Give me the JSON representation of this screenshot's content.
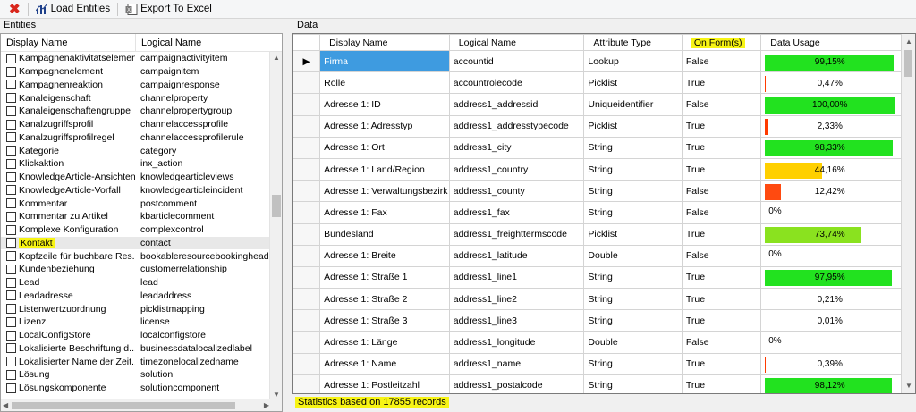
{
  "toolbar": {
    "load_label": "Load Entities",
    "export_label": "Export To Excel"
  },
  "entities_title": "Entities",
  "data_title": "Data",
  "left_columns": [
    "Display Name",
    "Logical Name"
  ],
  "entities": [
    {
      "display": "Kampagnenaktivitätselement",
      "logical": "campaignactivityitem"
    },
    {
      "display": "Kampagnenelement",
      "logical": "campaignitem"
    },
    {
      "display": "Kampagnenreaktion",
      "logical": "campaignresponse"
    },
    {
      "display": "Kanaleigenschaft",
      "logical": "channelproperty"
    },
    {
      "display": "Kanaleigenschaftengruppe",
      "logical": "channelpropertygroup"
    },
    {
      "display": "Kanalzugriffsprofil",
      "logical": "channelaccessprofile"
    },
    {
      "display": "Kanalzugriffsprofilregel",
      "logical": "channelaccessprofilerule"
    },
    {
      "display": "Kategorie",
      "logical": "category"
    },
    {
      "display": "Klickaktion",
      "logical": "inx_action"
    },
    {
      "display": "KnowledgeArticle-Ansichten",
      "logical": "knowledgearticleviews"
    },
    {
      "display": "KnowledgeArticle-Vorfall",
      "logical": "knowledgearticleincident"
    },
    {
      "display": "Kommentar",
      "logical": "postcomment"
    },
    {
      "display": "Kommentar zu Artikel",
      "logical": "kbarticlecomment"
    },
    {
      "display": "Komplexe Konfiguration",
      "logical": "complexcontrol"
    },
    {
      "display": "Kontakt",
      "logical": "contact",
      "selected": true
    },
    {
      "display": "Kopfzeile für buchbare Res...",
      "logical": "bookableresourcebookingheade"
    },
    {
      "display": "Kundenbeziehung",
      "logical": "customerrelationship"
    },
    {
      "display": "Lead",
      "logical": "lead"
    },
    {
      "display": "Leadadresse",
      "logical": "leadaddress"
    },
    {
      "display": "Listenwertzuordnung",
      "logical": "picklistmapping"
    },
    {
      "display": "Lizenz",
      "logical": "license"
    },
    {
      "display": "LocalConfigStore",
      "logical": "localconfigstore"
    },
    {
      "display": "Lokalisierte Beschriftung d...",
      "logical": "businessdatalocalizedlabel"
    },
    {
      "display": "Lokalisierter Name der Zeit...",
      "logical": "timezonelocalizedname"
    },
    {
      "display": "Lösung",
      "logical": "solution"
    },
    {
      "display": "Lösungskomponente",
      "logical": "solutioncomponent"
    }
  ],
  "grid_columns": [
    "Display Name",
    "Logical Name",
    "Attribute Type",
    "On Form(s)",
    "Data Usage"
  ],
  "rows": [
    {
      "display": "Firma",
      "logical": "accountid",
      "type": "Lookup",
      "onform": "False",
      "usage": "99,15%",
      "pct": 99.15,
      "color": "#22e21f",
      "selected": true
    },
    {
      "display": "Rolle",
      "logical": "accountrolecode",
      "type": "Picklist",
      "onform": "True",
      "usage": "0,47%",
      "pct": 0.47,
      "color": "#ff3b00"
    },
    {
      "display": "Adresse 1: ID",
      "logical": "address1_addressid",
      "type": "Uniqueidentifier",
      "onform": "False",
      "usage": "100,00%",
      "pct": 100,
      "color": "#22e21f"
    },
    {
      "display": "Adresse 1: Adresstyp",
      "logical": "address1_addresstypecode",
      "type": "Picklist",
      "onform": "True",
      "usage": "2,33%",
      "pct": 2.33,
      "color": "#ff3b00"
    },
    {
      "display": "Adresse 1: Ort",
      "logical": "address1_city",
      "type": "String",
      "onform": "True",
      "usage": "98,33%",
      "pct": 98.33,
      "color": "#22e21f"
    },
    {
      "display": "Adresse 1: Land/Region",
      "logical": "address1_country",
      "type": "String",
      "onform": "True",
      "usage": "44,16%",
      "pct": 44.16,
      "color": "#ffd000"
    },
    {
      "display": "Adresse 1: Verwaltungsbezirk",
      "logical": "address1_county",
      "type": "String",
      "onform": "False",
      "usage": "12,42%",
      "pct": 12.42,
      "color": "#ff4a10"
    },
    {
      "display": "Adresse 1: Fax",
      "logical": "address1_fax",
      "type": "String",
      "onform": "False",
      "usage": "0%",
      "pct": 0,
      "color": "#ff3b00"
    },
    {
      "display": "Bundesland",
      "logical": "address1_freighttermscode",
      "type": "Picklist",
      "onform": "True",
      "usage": "73,74%",
      "pct": 73.74,
      "color": "#8ae21f"
    },
    {
      "display": "Adresse 1: Breite",
      "logical": "address1_latitude",
      "type": "Double",
      "onform": "False",
      "usage": "0%",
      "pct": 0,
      "color": "#ff3b00"
    },
    {
      "display": "Adresse 1: Straße 1",
      "logical": "address1_line1",
      "type": "String",
      "onform": "True",
      "usage": "97,95%",
      "pct": 97.95,
      "color": "#22e21f"
    },
    {
      "display": "Adresse 1: Straße 2",
      "logical": "address1_line2",
      "type": "String",
      "onform": "True",
      "usage": "0,21%",
      "pct": 0.21,
      "color": "#ff3b00"
    },
    {
      "display": "Adresse 1: Straße 3",
      "logical": "address1_line3",
      "type": "String",
      "onform": "True",
      "usage": "0,01%",
      "pct": 0.01,
      "color": "#ff3b00"
    },
    {
      "display": "Adresse 1: Länge",
      "logical": "address1_longitude",
      "type": "Double",
      "onform": "False",
      "usage": "0%",
      "pct": 0,
      "color": "#ff3b00"
    },
    {
      "display": "Adresse 1: Name",
      "logical": "address1_name",
      "type": "String",
      "onform": "True",
      "usage": "0,39%",
      "pct": 0.39,
      "color": "#ff3b00"
    },
    {
      "display": "Adresse 1: Postleitzahl",
      "logical": "address1_postalcode",
      "type": "String",
      "onform": "True",
      "usage": "98,12%",
      "pct": 98.12,
      "color": "#22e21f"
    }
  ],
  "status_text": "Statistics based on 17855 records"
}
